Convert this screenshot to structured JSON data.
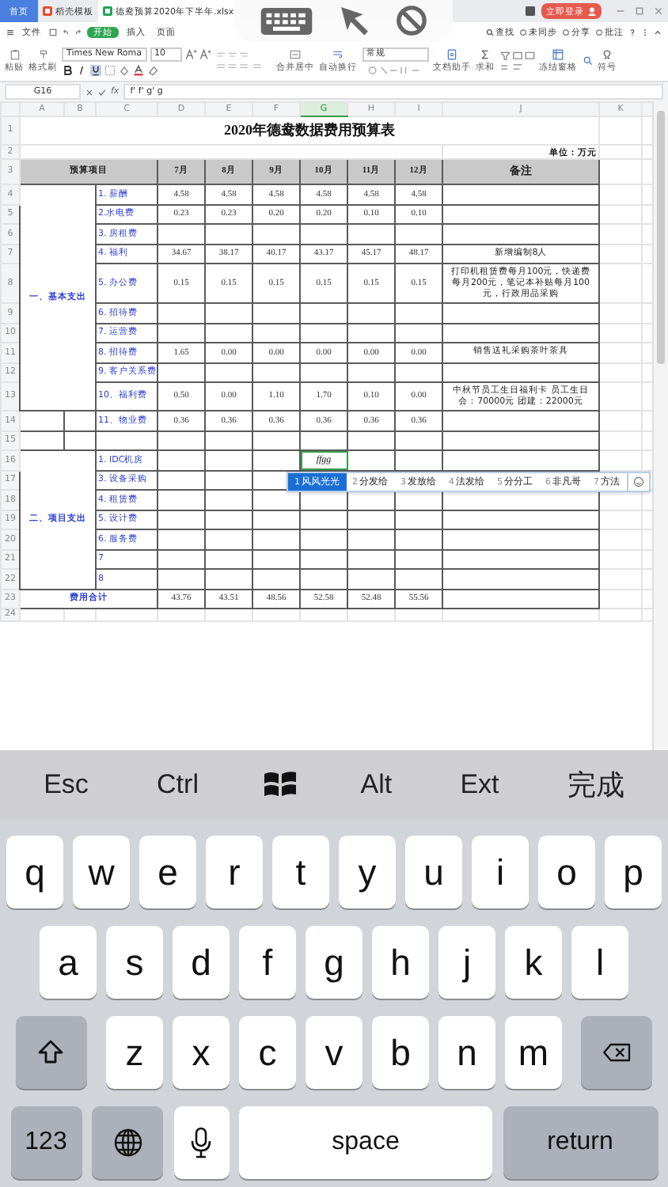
{
  "tabs": [
    {
      "kind": "home",
      "label": "首页",
      "selected": false
    },
    {
      "kind": "template",
      "label": "稻壳模板",
      "selected": false
    },
    {
      "kind": "sheet",
      "label": "德鸯预算2020年下半年.xlsx",
      "selected": true
    }
  ],
  "account": {
    "label": "立即登录"
  },
  "menu": {
    "items": [
      {
        "label": "文件",
        "selected": false
      },
      {
        "label": "开始",
        "selected": true
      },
      {
        "label": "插入",
        "selected": false
      },
      {
        "label": "页面",
        "selected": false
      }
    ],
    "search": "查找",
    "actions": [
      "未同步",
      "分享",
      "批注"
    ]
  },
  "ribbon": {
    "left_buttons": [
      {
        "kind": "paste",
        "label": "粘贴"
      },
      {
        "kind": "brush",
        "label": "格式刷"
      }
    ],
    "font": "Times New Roma",
    "size": "10",
    "mid_buttons": [
      {
        "kind": "merge",
        "label": "合并居中"
      },
      {
        "kind": "wrap",
        "label": "自动换行"
      }
    ],
    "number_format": "常规",
    "right_buttons": [
      {
        "kind": "assistant",
        "label": "文档助手"
      },
      {
        "kind": "sum",
        "label": "求和"
      },
      {
        "kind": "freeze",
        "label": "冻结窗格"
      },
      {
        "kind": "symbol",
        "label": "符号"
      }
    ]
  },
  "formula_bar": {
    "cell": "G16",
    "fx": "fx",
    "content": "f' f' g' g"
  },
  "sheet": {
    "columns": [
      {
        "label": "A",
        "selected": false
      },
      {
        "label": "B",
        "selected": false
      },
      {
        "label": "C",
        "selected": false
      },
      {
        "label": "D",
        "selected": false
      },
      {
        "label": "E",
        "selected": false
      },
      {
        "label": "F",
        "selected": false
      },
      {
        "label": "G",
        "selected": true
      },
      {
        "label": "H",
        "selected": false
      },
      {
        "label": "I",
        "selected": false
      },
      {
        "label": "J",
        "selected": false
      },
      {
        "label": "K",
        "selected": false
      }
    ],
    "title_row": {
      "number": "1",
      "text": "2020年德鸯数据费用预算表"
    },
    "unit_row": {
      "number": "2",
      "text": "单位：万元"
    },
    "header_row": {
      "number": "3",
      "item": "预算项目",
      "months": [
        "7月",
        "8月",
        "9月",
        "10月",
        "11月",
        "12月"
      ],
      "note": "备注"
    },
    "sections": [
      {
        "label": "一、基本支出",
        "rows": [
          {
            "number": "4",
            "label": "1. 薪酬",
            "values": [
              "4.58",
              "4.58",
              "4.58",
              "4.58",
              "4.58",
              "4.58"
            ]
          },
          {
            "number": "5",
            "label": "2.水电费",
            "values": [
              "0.23",
              "0.23",
              "0.20",
              "0.20",
              "0.10",
              "0.10"
            ]
          },
          {
            "number": "6",
            "label": "3. 房租费"
          },
          {
            "number": "7",
            "label": "4. 福利",
            "values": [
              "34.67",
              "38.17",
              "40.17",
              "43.17",
              "45.17",
              "48.17"
            ],
            "note": "新增编制8人"
          },
          {
            "number": "8",
            "label": "5. 办公费",
            "values": [
              "0.15",
              "0.15",
              "0.15",
              "0.15",
              "0.15",
              "0.15"
            ],
            "note": "打印机租赁费每月100元，快递费每月200元，笔记本补贴每月100元，行政用品采购"
          },
          {
            "number": "9",
            "label": "6. 招待费"
          },
          {
            "number": "10",
            "label": "7. 运营费"
          },
          {
            "number": "11",
            "label": "8. 招待费",
            "values": [
              "1.65",
              "0.00",
              "0.00",
              "0.00",
              "0.00",
              "0.00"
            ],
            "note": "销售送礼采购茶叶茶具"
          },
          {
            "number": "12",
            "label": "9. 客户关系费"
          },
          {
            "number": "13",
            "label": "10、福利费",
            "values": [
              "0.50",
              "0.00",
              "1.10",
              "1.70",
              "0.10",
              "0.00"
            ],
            "note": "中秋节员工生日福利卡 员工生日会：70000元 团建：22000元"
          }
        ]
      },
      {
        "rows": [
          {
            "number": "14",
            "label": "11、物业费",
            "values": [
              "0.36",
              "0.36",
              "0.36",
              "0.36",
              "0.36",
              "0.36"
            ]
          },
          {
            "number": "15"
          }
        ]
      },
      {
        "label": "二、项目支出",
        "rows": [
          {
            "number": "16",
            "label": "1. IDC机房",
            "active_cell": {
              "text": "ffgg",
              "selected": true
            }
          },
          {
            "number": "17",
            "label": "3. 设备采购"
          },
          {
            "number": "18",
            "label": "4. 租赁费"
          },
          {
            "number": "19",
            "label": "5. 设计费"
          },
          {
            "number": "20",
            "label": "6. 服务费"
          },
          {
            "number": "21",
            "label": "7"
          },
          {
            "number": "22",
            "label": "8"
          }
        ]
      }
    ],
    "total_row": {
      "number": "23",
      "label": "费用合计",
      "values": [
        "43.76",
        "43.51",
        "48.56",
        "52.58",
        "52.48",
        "55.56"
      ]
    },
    "trailing_rows": [
      "24"
    ]
  },
  "ime": {
    "candidates": [
      {
        "index": "1",
        "text": "风风光光",
        "selected": true
      },
      {
        "index": "2",
        "text": "分发给",
        "selected": false
      },
      {
        "index": "3",
        "text": "发放给",
        "selected": false
      },
      {
        "index": "4",
        "text": "法发给",
        "selected": false
      },
      {
        "index": "5",
        "text": "分分工",
        "selected": false
      },
      {
        "index": "6",
        "text": "非凡哥",
        "selected": false
      },
      {
        "index": "7",
        "text": "方法",
        "selected": false
      }
    ]
  },
  "keyboard": {
    "accessory": [
      {
        "kind": "text",
        "label": "Esc"
      },
      {
        "kind": "text",
        "label": "Ctrl"
      },
      {
        "kind": "windows"
      },
      {
        "kind": "text",
        "label": "Alt"
      },
      {
        "kind": "text",
        "label": "Ext"
      },
      {
        "kind": "done",
        "label": "完成"
      }
    ],
    "rows": [
      [
        "q",
        "w",
        "e",
        "r",
        "t",
        "y",
        "u",
        "i",
        "o",
        "p"
      ],
      [
        "a",
        "s",
        "d",
        "f",
        "g",
        "h",
        "j",
        "k",
        "l"
      ],
      [
        "z",
        "x",
        "c",
        "v",
        "b",
        "n",
        "m"
      ]
    ],
    "numbers": "123",
    "space": "space",
    "return": "return"
  }
}
